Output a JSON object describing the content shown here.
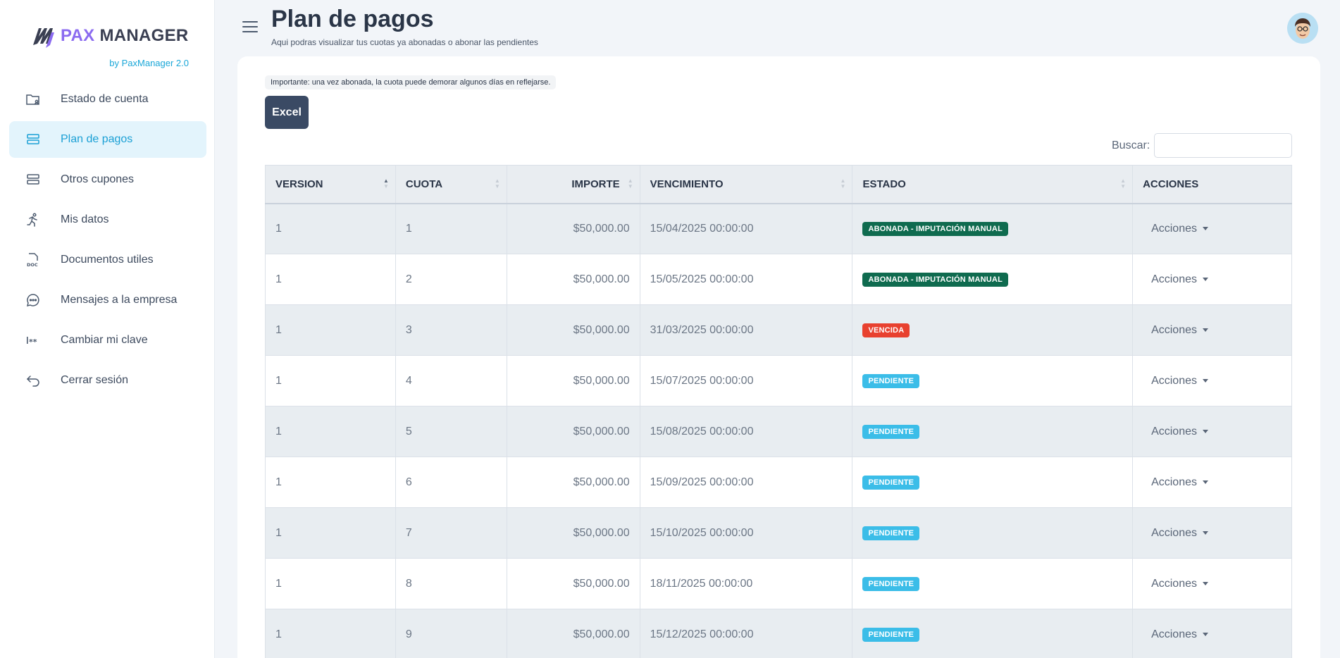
{
  "brand": {
    "logo_pax": "PAX",
    "logo_manager": "MANAGER",
    "subtitle": "by PaxManager 2.0",
    "accent_color": "#8b6bf0",
    "link_color": "#1aa7d8"
  },
  "sidebar": {
    "items": [
      {
        "label": "Estado de cuenta",
        "icon": "folder-user-icon",
        "active": false
      },
      {
        "label": "Plan de pagos",
        "icon": "server-stack-icon",
        "active": true
      },
      {
        "label": "Otros cupones",
        "icon": "server-stack-icon",
        "active": false
      },
      {
        "label": "Mis datos",
        "icon": "running-person-icon",
        "active": false
      },
      {
        "label": "Documentos utiles",
        "icon": "doc-file-icon",
        "active": false
      },
      {
        "label": "Mensajes a la empresa",
        "icon": "chat-bubble-icon",
        "active": false
      },
      {
        "label": "Cambiar mi clave",
        "icon": "password-icon",
        "active": false
      },
      {
        "label": "Cerrar sesión",
        "icon": "logout-arrow-icon",
        "active": false
      }
    ]
  },
  "header": {
    "title": "Plan de pagos",
    "subtitle": "Aqui podras visualizar tus cuotas ya abonadas o abonar las pendientes"
  },
  "notice": "Importante: una vez abonada, la cuota puede demorar algunos días en reflejarse.",
  "toolbar": {
    "excel_label": "Excel",
    "search_label": "Buscar:",
    "search_value": ""
  },
  "table": {
    "columns": [
      "VERSION",
      "CUOTA",
      "IMPORTE",
      "VENCIMIENTO",
      "ESTADO",
      "ACCIONES"
    ],
    "action_label": "Acciones",
    "rows": [
      {
        "version": "1",
        "cuota": "1",
        "importe": "$50,000.00",
        "vencimiento": "15/04/2025 00:00:00",
        "estado": "ABONADA - IMPUTACIÓN MANUAL",
        "estado_color": "#0f6b4f"
      },
      {
        "version": "1",
        "cuota": "2",
        "importe": "$50,000.00",
        "vencimiento": "15/05/2025 00:00:00",
        "estado": "ABONADA - IMPUTACIÓN MANUAL",
        "estado_color": "#0f6b4f"
      },
      {
        "version": "1",
        "cuota": "3",
        "importe": "$50,000.00",
        "vencimiento": "31/03/2025 00:00:00",
        "estado": "VENCIDA",
        "estado_color": "#e8412f"
      },
      {
        "version": "1",
        "cuota": "4",
        "importe": "$50,000.00",
        "vencimiento": "15/07/2025 00:00:00",
        "estado": "PENDIENTE",
        "estado_color": "#3bbde8"
      },
      {
        "version": "1",
        "cuota": "5",
        "importe": "$50,000.00",
        "vencimiento": "15/08/2025 00:00:00",
        "estado": "PENDIENTE",
        "estado_color": "#3bbde8"
      },
      {
        "version": "1",
        "cuota": "6",
        "importe": "$50,000.00",
        "vencimiento": "15/09/2025 00:00:00",
        "estado": "PENDIENTE",
        "estado_color": "#3bbde8"
      },
      {
        "version": "1",
        "cuota": "7",
        "importe": "$50,000.00",
        "vencimiento": "15/10/2025 00:00:00",
        "estado": "PENDIENTE",
        "estado_color": "#3bbde8"
      },
      {
        "version": "1",
        "cuota": "8",
        "importe": "$50,000.00",
        "vencimiento": "18/11/2025 00:00:00",
        "estado": "PENDIENTE",
        "estado_color": "#3bbde8"
      },
      {
        "version": "1",
        "cuota": "9",
        "importe": "$50,000.00",
        "vencimiento": "15/12/2025 00:00:00",
        "estado": "PENDIENTE",
        "estado_color": "#3bbde8"
      }
    ]
  }
}
